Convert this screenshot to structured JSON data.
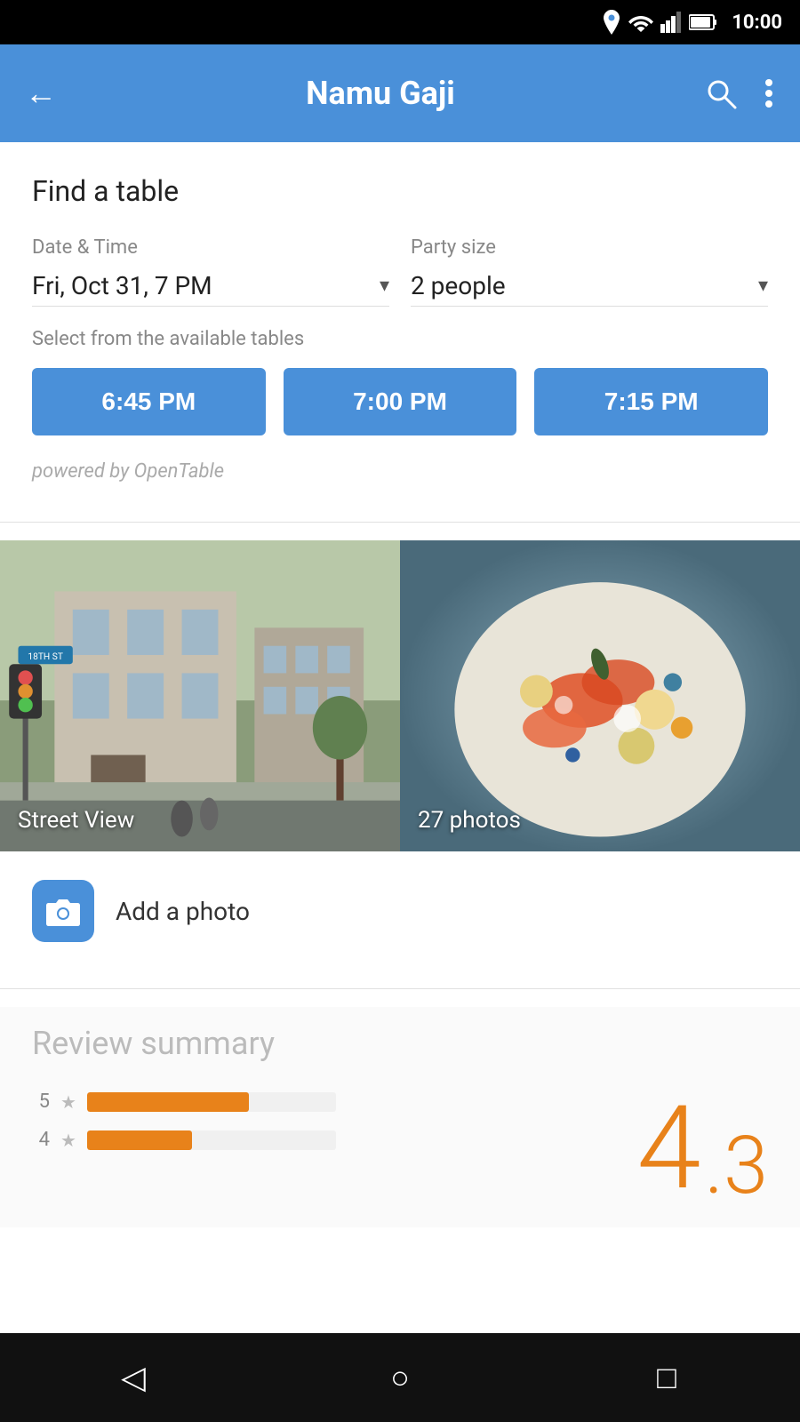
{
  "status_bar": {
    "time": "10:00"
  },
  "app_bar": {
    "back_label": "←",
    "title": "Namu Gaji",
    "search_icon": "search",
    "more_icon": "more"
  },
  "find_table": {
    "section_title": "Find a table",
    "date_time_label": "Date & Time",
    "date_time_value": "Fri, Oct 31, 7 PM",
    "party_size_label": "Party size",
    "party_size_value": "2 people",
    "available_tables_label": "Select from the available tables",
    "time_slots": [
      "6:45 PM",
      "7:00 PM",
      "7:15 PM"
    ],
    "opentable_credit": "powered by OpenTable"
  },
  "photos": {
    "street_view_label": "Street View",
    "photos_label": "27 photos"
  },
  "add_photo": {
    "label": "Add a photo"
  },
  "review_summary": {
    "title": "Review summary",
    "rating_value": "4",
    "rating_decimal": ".3",
    "bars": [
      {
        "star": 5,
        "fill_percent": 65
      },
      {
        "star": 4,
        "fill_percent": 42
      }
    ]
  },
  "bottom_nav": {
    "back": "◁",
    "home": "○",
    "recent": "□"
  }
}
